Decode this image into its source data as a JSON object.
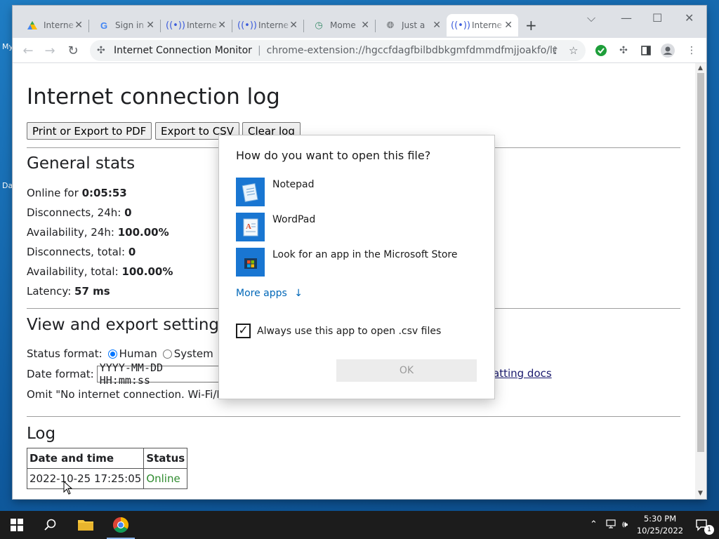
{
  "desktop": {
    "frag1": "My",
    "frag2": "Da"
  },
  "tabs": [
    {
      "icon": "drive-icon",
      "title": "Interne",
      "close": "✕"
    },
    {
      "icon": "google-icon",
      "title": "Sign in",
      "close": "✕"
    },
    {
      "icon": "signal-icon",
      "title": "Interne",
      "close": "✕"
    },
    {
      "icon": "signal-icon",
      "title": "Interne",
      "close": "✕"
    },
    {
      "icon": "clock-icon",
      "title": "Mome",
      "close": "✕"
    },
    {
      "icon": "globe-icon",
      "title": "Just a",
      "close": "✕"
    },
    {
      "icon": "signal-icon",
      "title": "Interne",
      "close": "✕"
    }
  ],
  "window_controls": {
    "dropdown": "⌵",
    "minimize": "—",
    "maximize": "☐",
    "close": "✕"
  },
  "toolbar": {
    "back": "←",
    "forward": "→",
    "reload": "↻",
    "host": "Internet Connection Monitor",
    "separator": "|",
    "url": "chrome-extension://hgccfdagfbilbdbkgmfdmmdfmjjoakfo/log.ht...",
    "new_tab": "+"
  },
  "page": {
    "title": "Internet connection log",
    "buttons": {
      "print": "Print or Export to PDF",
      "export_csv": "Export to CSV",
      "clear_log": "Clear log"
    },
    "general_stats": {
      "heading": "General stats",
      "online_for_label": "Online for",
      "online_for_value": "0:05:53",
      "disc24_label": "Disconnects, 24h:",
      "disc24_value": "0",
      "avail24_label": "Availability, 24h:",
      "avail24_value": "100.00%",
      "disc_total_label": "Disconnects, total:",
      "disc_total_value": "0",
      "avail_total_label": "Availability, total:",
      "avail_total_value": "100.00%",
      "latency_label": "Latency:",
      "latency_value": "57 ms"
    },
    "settings": {
      "heading": "View and export settings",
      "status_format_label": "Status format:",
      "status_human": "Human",
      "status_system": "System",
      "date_format_label": "Date format:",
      "date_format_value": "YYYY-MM-DD HH:mm:ss",
      "formatting_docs": "atting docs",
      "omit_text": "Omit \"No internet connection. Wi-Fi/Ethe"
    },
    "log": {
      "heading": "Log",
      "columns": [
        "Date and time",
        "Status"
      ],
      "rows": [
        {
          "datetime": "2022-10-25 17:25:05",
          "status": "Online"
        }
      ]
    }
  },
  "dialog": {
    "title": "How do you want to open this file?",
    "apps": [
      {
        "name": "Notepad",
        "icon": "notepad-icon"
      },
      {
        "name": "WordPad",
        "icon": "wordpad-icon"
      },
      {
        "name": "Look for an app in the Microsoft Store",
        "icon": "store-icon"
      }
    ],
    "more_apps": "More apps",
    "more_apps_arrow": "↓",
    "always_use": "Always use this app to open .csv files",
    "always_use_checked": true,
    "ok": "OK"
  },
  "taskbar": {
    "time": "5:30 PM",
    "date": "10/25/2022",
    "notification_count": "1"
  },
  "colors": {
    "accent_blue": "#0067b8",
    "online_green": "#2e8b2e",
    "taskbar": "#1c1c1c"
  }
}
